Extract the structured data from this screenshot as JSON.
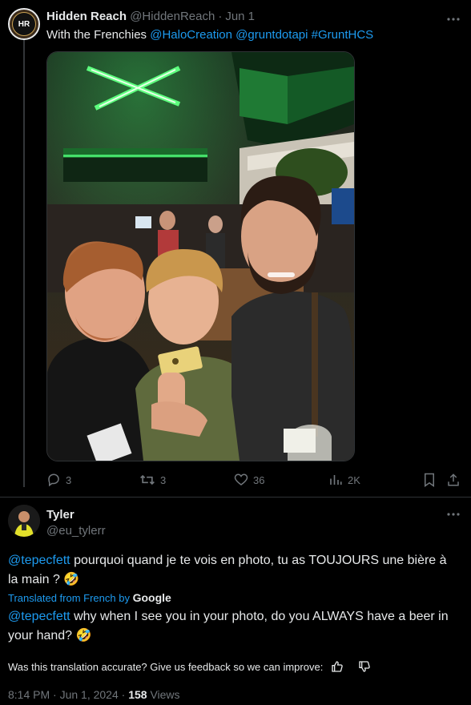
{
  "tweet": {
    "author_name": "Hidden Reach",
    "author_handle": "@HiddenReach",
    "separator": "·",
    "date": "Jun 1",
    "avatar_initials": "HR",
    "text_plain": "With the Frenchies",
    "mention1": "@HaloCreation",
    "mention2": "@gruntdotapi",
    "hashtag": "#GruntHCS",
    "stats": {
      "replies": "3",
      "retweets": "3",
      "likes": "36",
      "views": "2K"
    }
  },
  "reply": {
    "author_name": "Tyler",
    "author_handle": "@eu_tylerr",
    "mention": "@tepecfett",
    "text_fr": " pourquoi quand je te vois en photo, tu as TOUJOURS une bière à la main ?",
    "emoji": "🤣",
    "translated_label": "Translated from French by",
    "google": "Google",
    "text_en": " why when I see you in your photo, do you ALWAYS have a beer in your hand?",
    "feedback": "Was this translation accurate? Give us feedback so we can improve:",
    "timestamp": "8:14 PM · Jun 1, 2024 ·",
    "views_count": "158",
    "views_label": "Views"
  },
  "colors": {
    "accent": "#1d9bf0",
    "muted": "#71767b",
    "background": "#000000",
    "text": "#e7e9ea"
  },
  "icons": [
    "more-icon",
    "reply-icon",
    "retweet-icon",
    "like-icon",
    "views-icon",
    "bookmark-icon",
    "share-icon",
    "thumbs-up-icon",
    "thumbs-down-icon"
  ]
}
